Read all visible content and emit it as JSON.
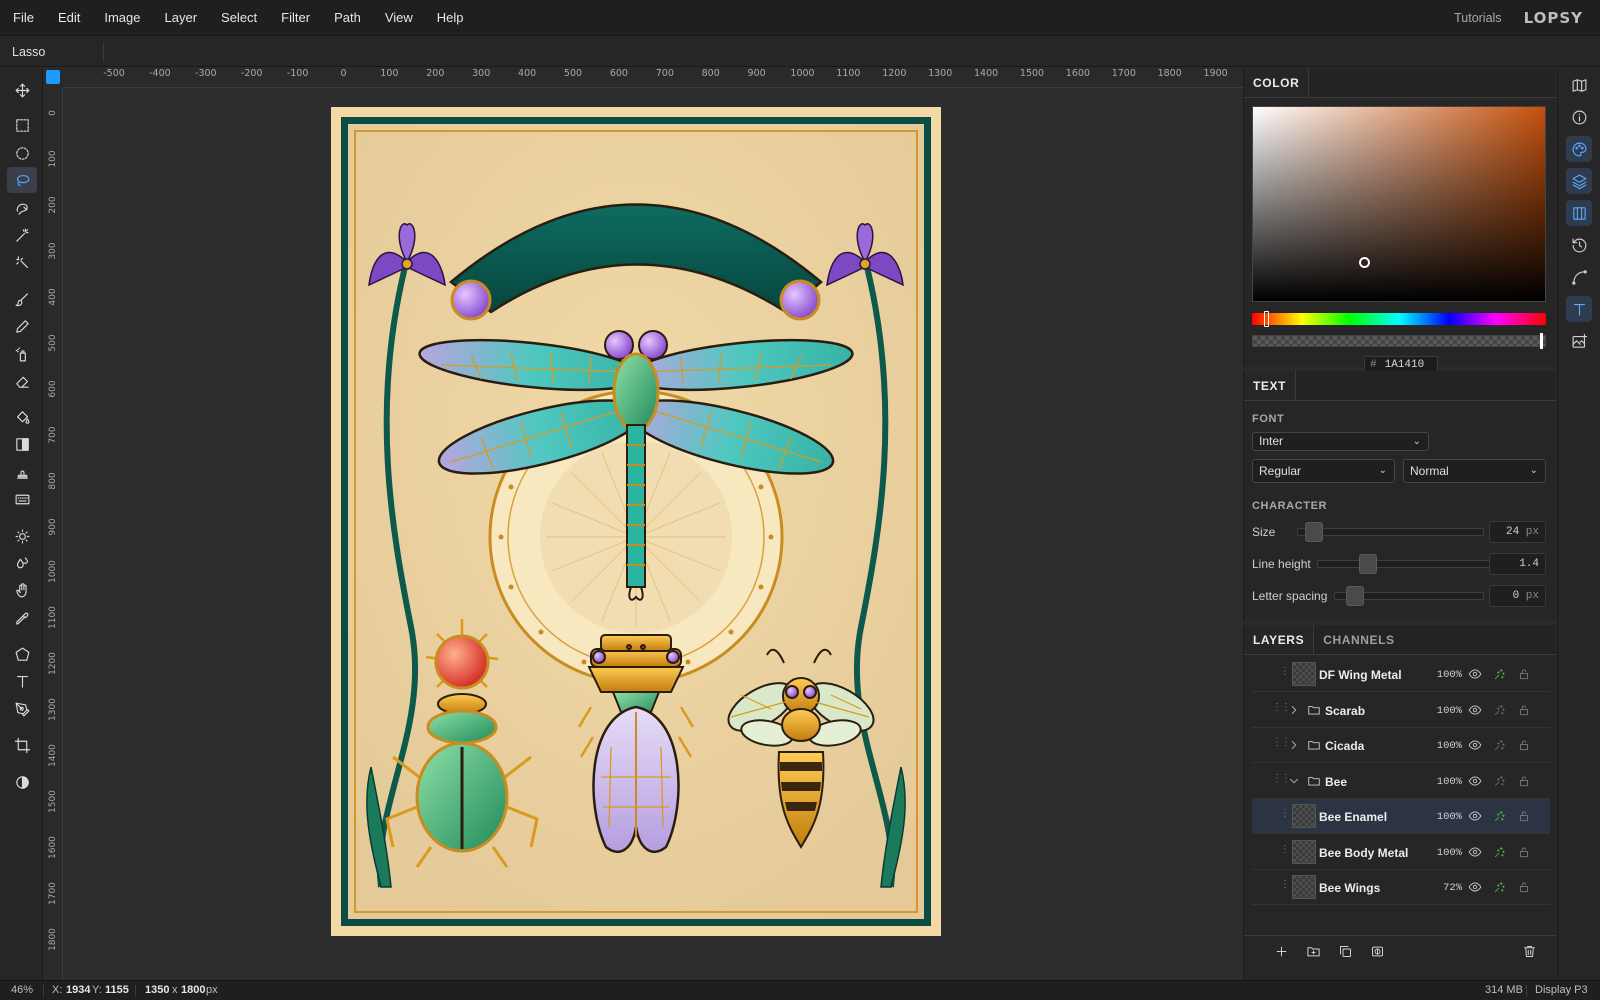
{
  "menubar": {
    "items": [
      "File",
      "Edit",
      "Image",
      "Layer",
      "Select",
      "Filter",
      "Path",
      "View",
      "Help"
    ],
    "tutorials": "Tutorials",
    "logo": "LOPSY"
  },
  "options_bar": {
    "tool_name": "Lasso"
  },
  "toolbar": {
    "active_tool": "lasso",
    "tools": [
      "move",
      "rect-select",
      "ellipse-select",
      "lasso",
      "magnetic-lasso",
      "magic-wand",
      "quick-select",
      "brush",
      "pencil",
      "spray",
      "eraser",
      "fill",
      "gradient",
      "stamp",
      "text-tool-alt",
      "dodge",
      "burn",
      "hand",
      "eyedropper",
      "polygon",
      "type",
      "pen",
      "crop",
      "adjust"
    ]
  },
  "rulers": {
    "top": [
      "-500",
      "-400",
      "-300",
      "-200",
      "-100",
      "0",
      "100",
      "200",
      "300",
      "400",
      "500",
      "600",
      "700",
      "800",
      "900",
      "1000",
      "1100",
      "1200",
      "1300",
      "1400",
      "1500",
      "1600",
      "1700",
      "1800",
      "1900"
    ],
    "left": [
      "0",
      "100",
      "200",
      "300",
      "400",
      "500",
      "600",
      "700",
      "800",
      "900",
      "1000",
      "1100",
      "1200",
      "1300",
      "1400",
      "1500",
      "1600",
      "1700",
      "1800"
    ]
  },
  "color_panel": {
    "title": "COLOR",
    "hex": "1A1410",
    "hash": "#",
    "base_hue_color": "#c4500c"
  },
  "text_panel": {
    "title": "TEXT",
    "font_label": "FONT",
    "font_family": "Inter",
    "weight": "Regular",
    "style": "Normal",
    "character_label": "CHARACTER",
    "size_label": "Size",
    "size_value": "24",
    "size_unit": "px",
    "line_height_label": "Line height",
    "line_height_value": "1.4",
    "letter_spacing_label": "Letter spacing",
    "letter_spacing_value": "0",
    "letter_spacing_unit": "px"
  },
  "layers_panel": {
    "tabs": [
      "LAYERS",
      "CHANNELS"
    ],
    "layers": [
      {
        "name": "DF Wing Metal",
        "opacity": "100%",
        "kind": "layer",
        "selected": false,
        "effects": true
      },
      {
        "name": "Scarab",
        "opacity": "100%",
        "kind": "group",
        "expanded": false,
        "selected": false,
        "effects": false
      },
      {
        "name": "Cicada",
        "opacity": "100%",
        "kind": "group",
        "expanded": false,
        "selected": false,
        "effects": false
      },
      {
        "name": "Bee",
        "opacity": "100%",
        "kind": "group",
        "expanded": true,
        "selected": false,
        "effects": false
      },
      {
        "name": "Bee Enamel",
        "opacity": "100%",
        "kind": "layer",
        "selected": true,
        "effects": true
      },
      {
        "name": "Bee Body Metal",
        "opacity": "100%",
        "kind": "layer",
        "selected": false,
        "effects": true
      },
      {
        "name": "Bee Wings",
        "opacity": "72%",
        "kind": "layer",
        "selected": false,
        "effects": true
      }
    ]
  },
  "status": {
    "zoom": "46%",
    "x_label": "X:",
    "x": "1934",
    "y_label": "Y:",
    "y": "1155",
    "width": "1350",
    "height": "1800",
    "size_sep": "x",
    "size_unit": "px",
    "memory": "314 MB",
    "color_profile": "Display P3"
  },
  "colors": {
    "accent": "#4ea5ff",
    "effects_green": "#4caf50",
    "teal_frame": "#0b4d45",
    "parchment": "#ecd3a2"
  }
}
